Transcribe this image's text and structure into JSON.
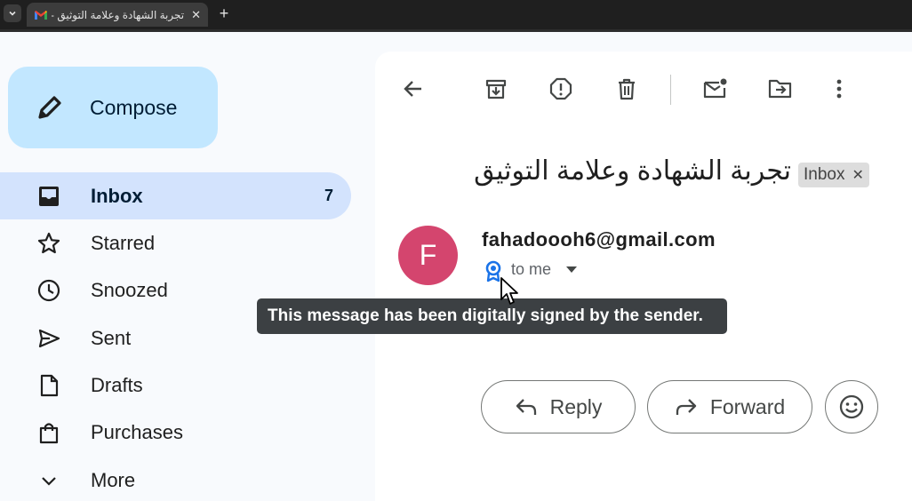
{
  "browser": {
    "tab_title": "تجربة الشهادة وعلامة التوثيق - ail",
    "favicon": "gmail-icon"
  },
  "sidebar": {
    "compose_label": "Compose",
    "items": [
      {
        "label": "Inbox",
        "icon": "inbox-icon",
        "count": "7",
        "active": true
      },
      {
        "label": "Starred",
        "icon": "star-icon"
      },
      {
        "label": "Snoozed",
        "icon": "clock-icon"
      },
      {
        "label": "Sent",
        "icon": "send-icon"
      },
      {
        "label": "Drafts",
        "icon": "draft-icon"
      },
      {
        "label": "Purchases",
        "icon": "bag-icon"
      },
      {
        "label": "More",
        "icon": "chevron-down-icon"
      }
    ]
  },
  "toolbar": {
    "icons": [
      "back-arrow-icon",
      "archive-icon",
      "report-spam-icon",
      "delete-icon",
      "mark-unread-icon",
      "move-to-icon",
      "more-vert-icon"
    ]
  },
  "message": {
    "subject": "تجربة الشهادة وعلامة التوثيق",
    "label": "Inbox",
    "avatar_letter": "F",
    "avatar_color": "#d4456e",
    "sender": "fahadoooh6@gmail.com",
    "recipient": "to me",
    "tooltip": "This message has been digitally signed by the sender."
  },
  "actions": {
    "reply_label": "Reply",
    "forward_label": "Forward"
  },
  "colors": {
    "compose_bg": "#c2e7ff",
    "active_nav_bg": "#d3e3fd",
    "page_bg": "#f8fafd",
    "tooltip_bg": "#3c4043"
  }
}
